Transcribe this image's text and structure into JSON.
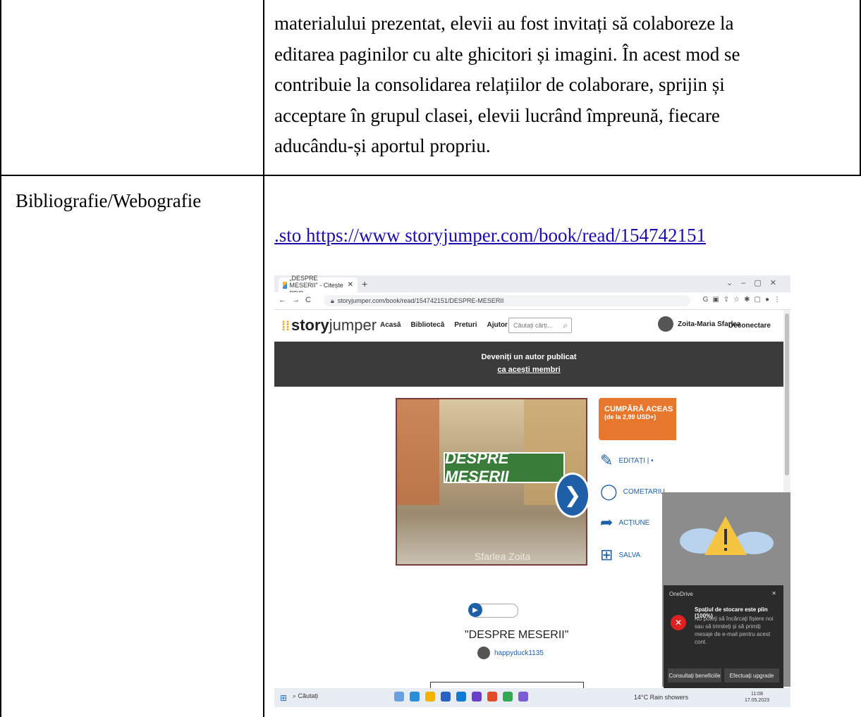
{
  "document": {
    "body_lines": [
      "materialului prezentat, elevii au fost invitați să colaboreze la",
      "editarea paginilor cu alte ghicitori și imagini. În acest mod se",
      "contribuie la consolidarea relațiilor de colaborare, sprijin și",
      "acceptare în grupul clasei, elevii lucrând împreună, fiecare",
      "aducându-și aportul propriu."
    ],
    "label": "Bibliografie/Webografie",
    "link": ".sto https://www storyjumper.com/book/read/154742151"
  },
  "screenshot": {
    "tab_title": "„DESPRE MESERII\" - Citește pove",
    "url": "storyjumper.com/book/read/154742151/DESPRE-MESERII",
    "logo_a": "story",
    "logo_b": "jumper",
    "menu": [
      "Acasă",
      "Bibliotecă",
      "Preturi",
      "Ajutor"
    ],
    "search_placeholder": "Căutați cărți...",
    "user_name": "Zoita-Maria Sfarlea",
    "logout": "Deconectare",
    "banner_line1": "Deveniți un autor publicat",
    "banner_line2": "ca acești membri",
    "cover_sign": "DESPRE MESERII",
    "cover_author": "Sfarlea Zoita",
    "buy_title": "CUMPĂRĂ ACEAS",
    "buy_sub": "(de la 2,99 USD+)",
    "actions": [
      "EDITAȚI | •",
      "COMETARIU",
      "ACȚIUNE",
      "SALVA"
    ],
    "book_title": "\"DESPRE MESERII\"",
    "book_user": "happyduck1135",
    "onedrive": {
      "app": "OneDrive",
      "title": "Spațiul de stocare este plin (100%)",
      "message": "Nu puteți să încărcați fișiere noi sau să trimiteți și să primiți mesaje de e-mail pentru acest cont.",
      "btn1": "Consultați beneficiile",
      "btn2": "Efectuați upgrade"
    },
    "taskbar": {
      "search": "Căutați",
      "weather": "14°C Rain showers",
      "lang": "ROU",
      "time": "11:08",
      "date": "17.05.2023"
    },
    "colors": {
      "orange": "#e8772e",
      "blue": "#1e5fa8",
      "banner": "#3b3b3b"
    }
  }
}
